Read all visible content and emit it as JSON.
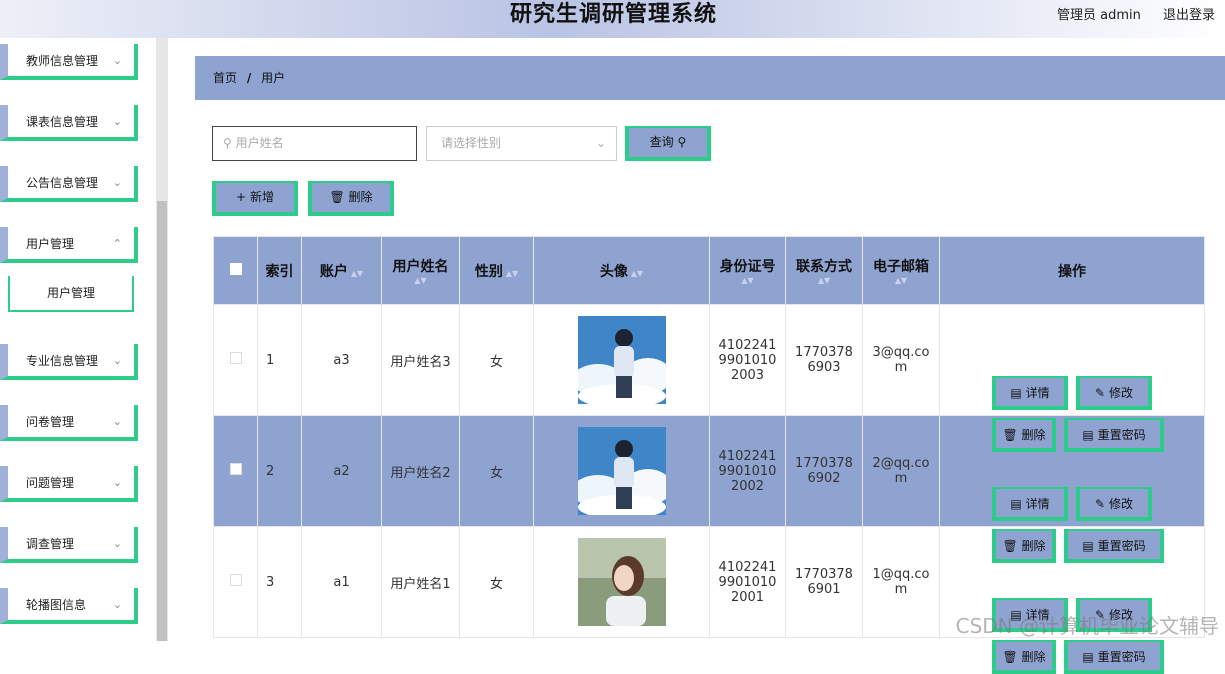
{
  "header": {
    "title": "研究生调研管理系统",
    "user_label": "管理员 admin",
    "logout_label": "退出登录"
  },
  "sidebar": {
    "items": [
      {
        "label": "教师信息管理"
      },
      {
        "label": "课表信息管理"
      },
      {
        "label": "公告信息管理"
      },
      {
        "label": "用户管理"
      },
      {
        "label": "专业信息管理"
      },
      {
        "label": "问卷管理"
      },
      {
        "label": "问题管理"
      },
      {
        "label": "调查管理"
      },
      {
        "label": "轮播图信息"
      }
    ],
    "sub_item": "用户管理",
    "chevron": "chevron-down-icon"
  },
  "breadcrumb": {
    "home": "首页",
    "separator": "/",
    "current": "用户"
  },
  "filters": {
    "name_placeholder": "用户姓名",
    "gender_placeholder": "请选择性别",
    "query_label": "查询"
  },
  "actions": {
    "add_label": "新增",
    "delete_label": "删除"
  },
  "table": {
    "headers": {
      "index": "索引",
      "account": "账户",
      "name": "用户姓名",
      "gender": "性别",
      "avatar": "头像",
      "id_number": "身份证号",
      "phone": "联系方式",
      "email": "电子邮箱",
      "ops": "操作"
    },
    "rows": [
      {
        "index": "1",
        "account": "a3",
        "name": "用户姓名3",
        "gender": "女",
        "id_number": "410224199010102003",
        "phone": "17703786903",
        "email": "3@qq.com",
        "avatar": "boy-clouds"
      },
      {
        "index": "2",
        "account": "a2",
        "name": "用户姓名2",
        "gender": "女",
        "id_number": "410224199010102002",
        "phone": "17703786902",
        "email": "2@qq.com",
        "avatar": "boy-clouds"
      },
      {
        "index": "3",
        "account": "a1",
        "name": "用户姓名1",
        "gender": "女",
        "id_number": "410224199010102001",
        "phone": "17703786901",
        "email": "1@qq.com",
        "avatar": "girl-forest"
      }
    ],
    "op_labels": {
      "detail": "详情",
      "edit": "修改",
      "remove": "删除",
      "reset": "重置密码"
    }
  },
  "watermark": "CSDN @计算机毕业论文辅导",
  "colors": {
    "accent": "#8fa3d1",
    "border_green": "#2ecc8a"
  }
}
